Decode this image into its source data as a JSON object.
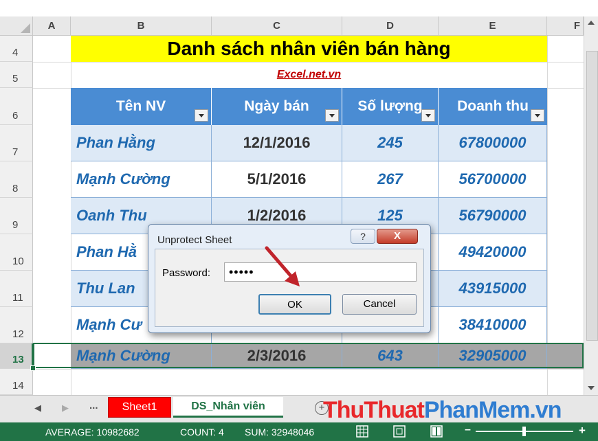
{
  "columns": [
    "A",
    "B",
    "C",
    "D",
    "E",
    "F"
  ],
  "rows": [
    "4",
    "5",
    "6",
    "7",
    "8",
    "9",
    "10",
    "11",
    "12",
    "13",
    "14"
  ],
  "title": "Danh sách nhân viên bán hàng",
  "subtitle": "Excel.net.vn",
  "table": {
    "headers": [
      "Tên NV",
      "Ngày bán",
      "Số lượng",
      "Doanh thu"
    ],
    "rows": [
      {
        "name": "Phan Hằng",
        "date": "12/1/2016",
        "qty": "245",
        "rev": "67800000"
      },
      {
        "name": "Mạnh Cường",
        "date": "5/1/2016",
        "qty": "267",
        "rev": "56700000"
      },
      {
        "name": "Oanh Thu",
        "date": "1/2/2016",
        "qty": "125",
        "rev": "56790000"
      },
      {
        "name": "Phan Hằ",
        "date": "",
        "qty": "",
        "rev": "49420000"
      },
      {
        "name": "Thu Lan",
        "date": "",
        "qty": "",
        "rev": "43915000"
      },
      {
        "name": "Mạnh Cư",
        "date": "",
        "qty": "",
        "rev": "38410000"
      },
      {
        "name": "Mạnh Cường",
        "date": "2/3/2016",
        "qty": "643",
        "rev": "32905000"
      }
    ]
  },
  "tabs": {
    "ellipsis": "...",
    "sheet1": "Sheet1",
    "active": "DS_Nhân viên"
  },
  "watermark": {
    "part1": "ThuThuat",
    "part2": "PhanMem.vn"
  },
  "status": {
    "average": "AVERAGE: 10982682",
    "count": "COUNT: 4",
    "sum": "SUM: 32948046"
  },
  "dialog": {
    "title": "Unprotect Sheet",
    "help": "?",
    "close": "X",
    "password_label": "Password:",
    "password_value": "•••••",
    "ok": "OK",
    "cancel": "Cancel"
  },
  "colors": {
    "header_fill": "#4a8cd3",
    "title_fill": "#ffff00",
    "status_bar": "#217346",
    "sheet1_tab": "#ff0000"
  }
}
